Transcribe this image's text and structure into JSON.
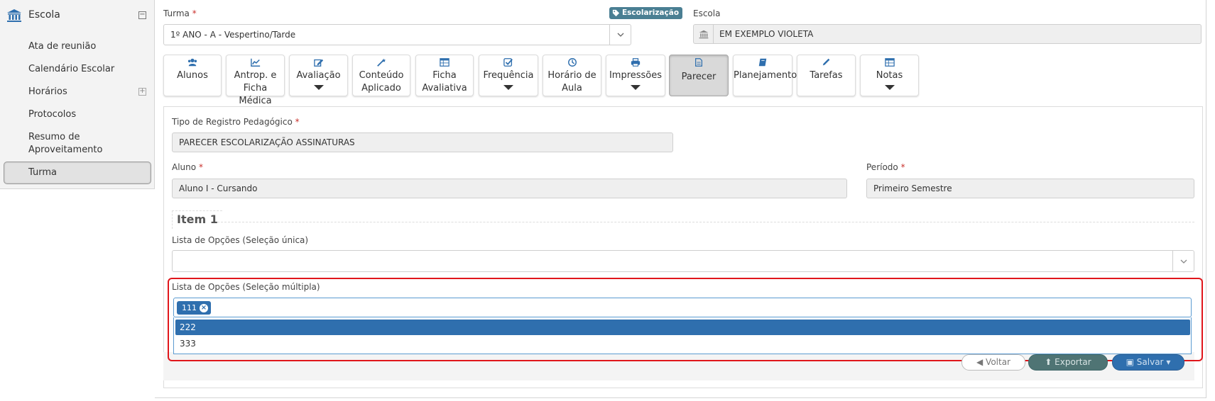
{
  "sidebar": {
    "title": "Escola",
    "items": [
      {
        "label": "Ata de reunião"
      },
      {
        "label": "Calendário Escolar"
      },
      {
        "label": "Horários"
      },
      {
        "label": "Protocolos"
      },
      {
        "label": "Resumo de Aproveitamento"
      },
      {
        "label": "Turma"
      }
    ]
  },
  "header": {
    "turma_label": "Turma",
    "required_mark": "*",
    "badge": "Escolarização",
    "turma_value": "1º ANO - A - Vespertino/Tarde",
    "escola_label": "Escola",
    "escola_value": "EM EXEMPLO VIOLETA"
  },
  "toolbar": [
    {
      "label": "Alunos",
      "icon": "users-icon"
    },
    {
      "label": "Antrop. e Ficha Médica",
      "icon": "line-chart-icon"
    },
    {
      "label": "Avaliação",
      "icon": "edit-icon"
    },
    {
      "label": "Conteúdo Aplicado",
      "icon": "magic-wand-icon"
    },
    {
      "label": "Ficha Avaliativa",
      "icon": "table-icon"
    },
    {
      "label": "Frequência",
      "icon": "check-square-icon"
    },
    {
      "label": "Horário de Aula",
      "icon": "clock-icon"
    },
    {
      "label": "Impressões",
      "icon": "print-icon"
    },
    {
      "label": "Parecer",
      "icon": "file-icon"
    },
    {
      "label": "Planejamento",
      "icon": "book-icon"
    },
    {
      "label": "Tarefas",
      "icon": "pencil-icon"
    },
    {
      "label": "Notas",
      "icon": "table-icon"
    }
  ],
  "form": {
    "tipo_label": "Tipo de Registro Pedagógico",
    "tipo_value": "PARECER ESCOLARIZAÇÃO ASSINATURAS",
    "aluno_label": "Aluno",
    "aluno_value": "Aluno I - Cursando",
    "periodo_label": "Período",
    "periodo_value": "Primeiro Semestre",
    "item_title": "Item 1",
    "unica_label": "Lista de Opções (Seleção única)",
    "multipla_label": "Lista de Opções (Seleção múltipla)",
    "chip_value": "111",
    "chip_remove": "×",
    "options": [
      "222",
      "333"
    ]
  },
  "actions": {
    "voltar": "Voltar",
    "exportar": "Exportar",
    "salvar": "Salvar"
  },
  "colors": {
    "accent": "#2f6fae",
    "badge": "#4a7f93",
    "highlight": "#e0161b",
    "required": "#c9302c"
  }
}
